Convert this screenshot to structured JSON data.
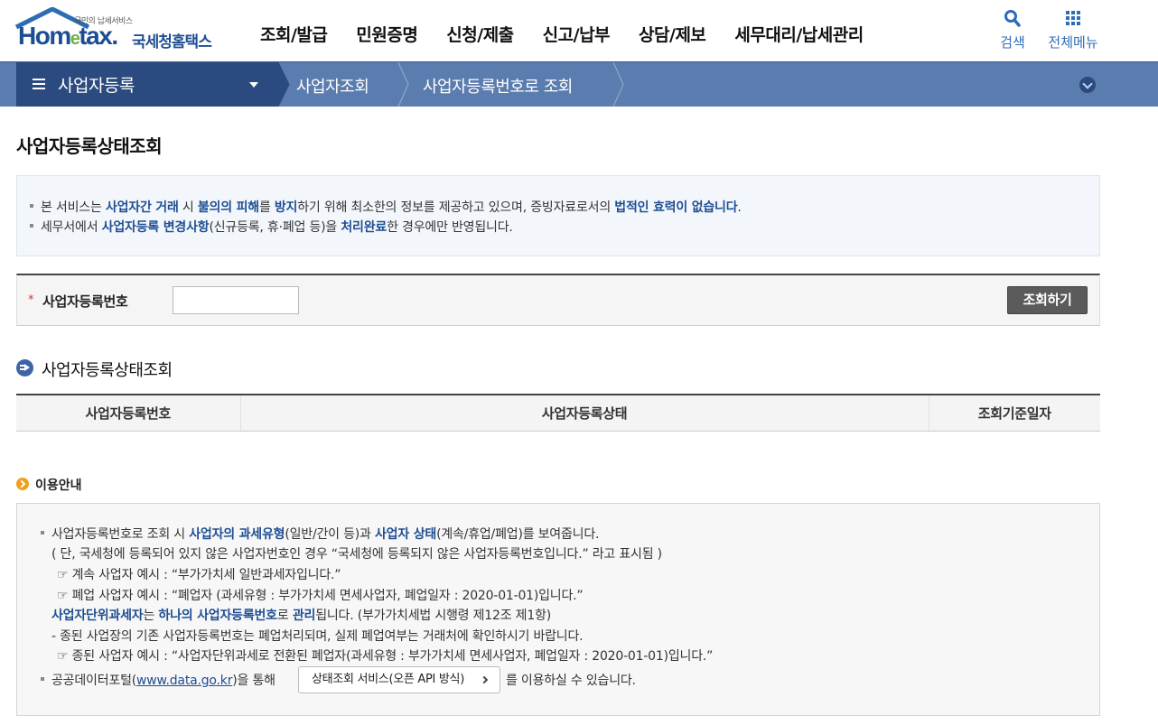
{
  "header": {
    "logo_small": "국민의 납세서비스",
    "logo_brand_a": "Hom",
    "logo_brand_e": "e",
    "logo_brand_b": "tax.",
    "logo_kr": "국세청홈택스",
    "gnb": [
      "조회/발급",
      "민원증명",
      "신청/제출",
      "신고/납부",
      "상담/제보",
      "세무대리/납세관리"
    ],
    "search_label": "검색",
    "allmenu_label": "전체메뉴"
  },
  "location": {
    "menu_label": "사업자등록",
    "crumbs": [
      "사업자조회",
      "사업자등록번호로 조회"
    ]
  },
  "page": {
    "title": "사업자등록상태조회"
  },
  "notice": {
    "line1": {
      "a": "본 서비스는 ",
      "b": "사업자간 거래",
      "c": " 시 ",
      "d": "불의의 피해",
      "e": "를 ",
      "f": "방지",
      "g": "하기 위해 최소한의 정보를 제공하고 있으며, 증빙자료로서의 ",
      "h": "법적인 효력이 없습니다",
      "i": "."
    },
    "line2": {
      "a": "세무서에서 ",
      "b": "사업자등록 변경사항",
      "c": "(신규등록, 휴·폐업 등)을 ",
      "d": "처리완료",
      "e": "한 경우에만 반영됩니다."
    }
  },
  "search": {
    "required_mark": "*",
    "label": "사업자등록번호",
    "input_value": "",
    "button": "조회하기"
  },
  "result": {
    "section_title": "사업자등록상태조회",
    "columns": [
      "사업자등록번호",
      "사업자등록상태",
      "조회기준일자"
    ],
    "rows": []
  },
  "guide": {
    "title": "이용안내",
    "l1": {
      "a": "사업자등록번호로 조회 시 ",
      "b": "사업자의 과세유형",
      "c": "(일반/간이 등)과 ",
      "d": "사업자 상태",
      "e": "(계속/휴업/폐업)를 보여줍니다."
    },
    "l2": "( 단, 국세청에 등록되어 있지 않은 사업자번호인 경우 “국세청에 등록되지 않은 사업자등록번호입니다.” 라고 표시됨 )",
    "l3": "☞ 계속 사업자 예시 : “부가가치세 일반과세자입니다.”",
    "l4": "☞ 폐업 사업자 예시 : “폐업자 (과세유형 : 부가가치세 면세사업자, 폐업일자 : 2020-01-01)입니다.”",
    "l5": {
      "a": "사업자단위과세자",
      "b": "는 ",
      "c": "하나의 사업자등록번호",
      "d": "로 ",
      "e": "관리",
      "f": "됩니다. (부가가치세법 시행령 제12조 제1항)"
    },
    "l6": "- 종된 사업장의 기존 사업자등록번호는 폐업처리되며, 실제 폐업여부는 거래처에 확인하시기 바랍니다.",
    "l7": "☞ 종된 사업자 예시 : “사업자단위과세로 전환된 폐업자(과세유형 : 부가가치세 면세사업자, 폐업일자 : 2020-01-01)입니다.”",
    "l8": {
      "a": "공공데이터포털(",
      "link": "www.data.go.kr",
      "b": ")을 통해",
      "btn": "상태조회 서비스(오픈 API 방식)",
      "c": "를 이용하실 수 있습니다."
    }
  },
  "colors": {
    "brand": "#1e4e92",
    "locbar": "#5b7cae",
    "locbar_active": "#2b4a7f",
    "button": "#5b5b5b"
  }
}
